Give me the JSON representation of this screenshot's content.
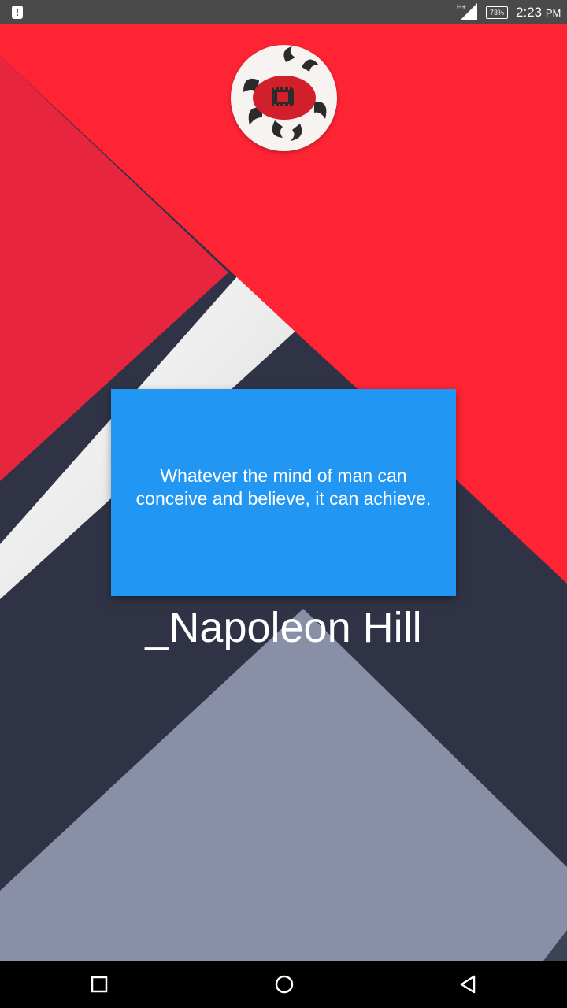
{
  "status_bar": {
    "network": "H+",
    "battery": "73%",
    "time": "2:23",
    "time_suffix": "PM",
    "alert_icon": "!"
  },
  "quote": {
    "text": "Whatever the mind of man can conceive and believe, it can achieve.",
    "author": "_Napoleon Hill"
  },
  "colors": {
    "card": "#2196f3",
    "red": "#fe2434",
    "dark": "#2f3345",
    "grey": "#8a8fa8"
  },
  "icons": {
    "logo": "crab-logo-icon",
    "nav_back": "back-triangle-icon",
    "nav_home": "home-circle-icon",
    "nav_recent": "recent-apps-square-icon"
  }
}
